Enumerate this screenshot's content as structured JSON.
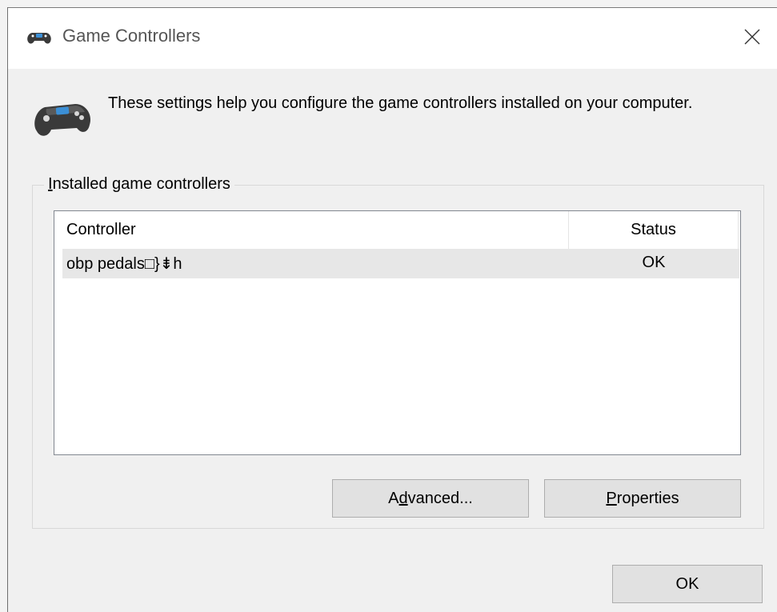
{
  "window": {
    "title": "Game Controllers",
    "close_glyph": "✕",
    "title_icon": "gamepad-icon",
    "close_icon": "close-icon"
  },
  "intro": {
    "text": "These settings help you configure the game controllers installed on your computer.",
    "icon": "gamepad-icon"
  },
  "group": {
    "label_prefix": "",
    "label_accel": "I",
    "label_rest": "nstalled game controllers"
  },
  "list": {
    "columns": {
      "controller": "Controller",
      "status": "Status"
    },
    "rows": [
      {
        "name": "obp pedals□}⇟h",
        "status": "OK"
      }
    ]
  },
  "buttons": {
    "advanced": {
      "prefix": "A",
      "accel": "d",
      "rest": "vanced..."
    },
    "properties": {
      "prefix": "",
      "accel": "P",
      "rest": "roperties"
    },
    "ok": {
      "label": "OK"
    }
  },
  "colors": {
    "client_bg": "#f0f0f0",
    "button_bg": "#e1e1e1",
    "selected_row": "#e7e7e7",
    "gamepad_blue": "#3b8fd6",
    "gamepad_dark": "#3a3a3a"
  }
}
